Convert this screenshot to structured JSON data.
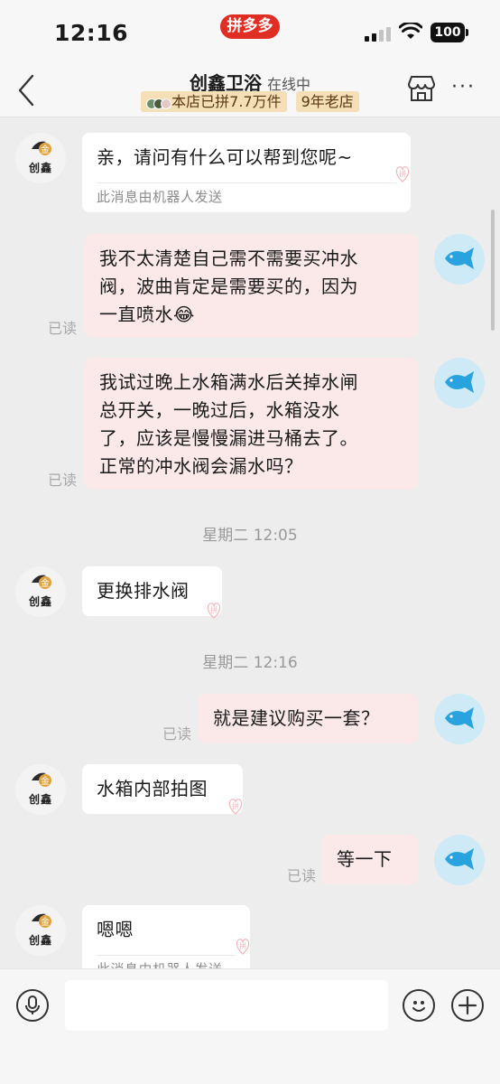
{
  "status_bar": {
    "time": "12:16",
    "app_badge": "拼多多",
    "battery": "100"
  },
  "header": {
    "shop_name": "创鑫卫浴",
    "online_status": "在线中",
    "tags": [
      "本店已拼7.7万件",
      "9年老店"
    ]
  },
  "merchant_avatar": {
    "logo_text": "创鑫"
  },
  "messages": [
    {
      "from": "merchant",
      "text": "亲，请问有什么可以帮到您呢~",
      "note": "此消息由机器人发送"
    },
    {
      "from": "user",
      "text": "我不太清楚自己需不需要买冲水\n阀，波曲肯定是需要买的，因为\n一直喷水😂",
      "read": "已读"
    },
    {
      "from": "user",
      "text": "我试过晚上水箱满水后关掉水闸\n总开关，一晚过后，水箱没水\n了，应该是慢慢漏进马桶去了。\n正常的冲水阀会漏水吗？",
      "read": "已读"
    },
    {
      "from": "divider",
      "text": "星期二 12:05"
    },
    {
      "from": "merchant",
      "text": "更换排水阀"
    },
    {
      "from": "divider",
      "text": "星期二 12:16"
    },
    {
      "from": "user",
      "text": "就是建议购买一套？",
      "read": "已读"
    },
    {
      "from": "merchant",
      "text": "水箱内部拍图"
    },
    {
      "from": "user",
      "text": "等一下",
      "read": "已读"
    },
    {
      "from": "merchant",
      "text": "嗯嗯",
      "note": "此消息由机器人发送"
    }
  ],
  "input_bar": {
    "placeholder": ""
  },
  "colors": {
    "brand_red": "#e02e24",
    "user_bubble": "#fbe9ea",
    "tag_bg": "#f4dfb6",
    "user_avatar_bg": "#cfeaf7",
    "user_avatar_fish": "#29a3df"
  }
}
